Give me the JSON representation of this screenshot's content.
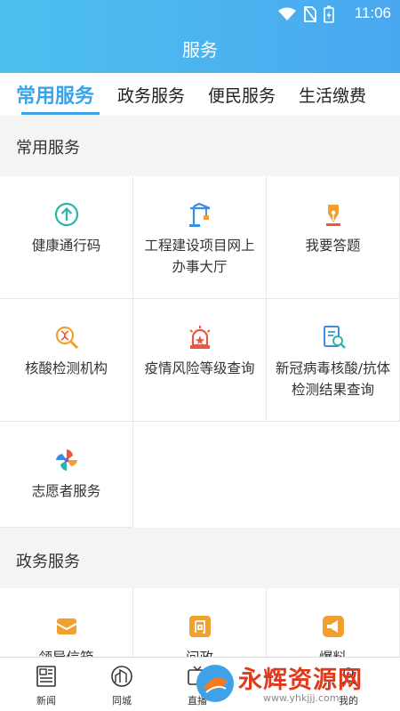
{
  "status": {
    "time": "11:06"
  },
  "header": {
    "title": "服务"
  },
  "tabs": [
    "常用服务",
    "政务服务",
    "便民服务",
    "生活缴费"
  ],
  "sections": {
    "common": {
      "title": "常用服务",
      "items": [
        {
          "label": "健康通行码",
          "icon": "arrow-up-circle-icon"
        },
        {
          "label": "工程建设项目网上办事大厅",
          "icon": "crane-icon"
        },
        {
          "label": "我要答题",
          "icon": "pen-nib-icon"
        },
        {
          "label": "核酸检测机构",
          "icon": "dna-search-icon"
        },
        {
          "label": "疫情风险等级查询",
          "icon": "alarm-light-icon"
        },
        {
          "label": "新冠病毒核酸/抗体检测结果查询",
          "icon": "report-search-icon"
        },
        {
          "label": "志愿者服务",
          "icon": "pinwheel-icon"
        }
      ]
    },
    "gov": {
      "title": "政务服务",
      "items": [
        {
          "label": "领导信箱",
          "icon": "mail-icon"
        },
        {
          "label": "问政",
          "icon": "question-icon"
        },
        {
          "label": "爆料",
          "icon": "megaphone-icon"
        }
      ]
    }
  },
  "bottom_nav": [
    {
      "label": "新闻",
      "icon": "newspaper-icon"
    },
    {
      "label": "同城",
      "icon": "city-icon"
    },
    {
      "label": "直播",
      "icon": "live-icon"
    },
    {
      "label": "我的",
      "icon": "user-icon"
    }
  ],
  "watermark": {
    "text": "永辉资源网",
    "url": "www.yhkjjj.com"
  },
  "colors": {
    "accent": "#3aa3ea",
    "teal": "#2bb5a8",
    "orange": "#f0a030",
    "red": "#e9573f"
  }
}
